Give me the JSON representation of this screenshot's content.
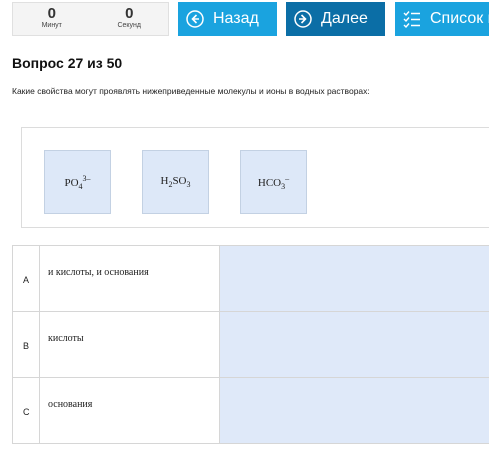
{
  "timer": {
    "minutes_value": "0",
    "minutes_label": "Минут",
    "seconds_value": "0",
    "seconds_label": "Секунд"
  },
  "nav": {
    "back_label": "Назад",
    "next_label": "Далее",
    "list_label": "Список в"
  },
  "question": {
    "title": "Вопрос 27 из 50",
    "text": "Какие свойства могут проявлять нижеприведенные молекулы и ионы в водных растворах:"
  },
  "options": [
    {
      "base": "PO",
      "sub": "4",
      "sup": "3–"
    },
    {
      "pre": "H",
      "sub1": "2",
      "mid": "SO",
      "sub2": "3"
    },
    {
      "base": "HCO",
      "sub": "3",
      "sup": "–"
    }
  ],
  "answers": [
    {
      "letter": "A",
      "text": "и кислоты, и основания"
    },
    {
      "letter": "B",
      "text": "кислоты"
    },
    {
      "letter": "C",
      "text": "основания"
    }
  ],
  "colors": {
    "button_light": "#1aa3df",
    "button_dark": "#0b6ea6",
    "chip_fill": "#dde8f8",
    "drop_zone": "#dfe9f9"
  },
  "icons": [
    "arrow-left-circle-icon",
    "arrow-right-circle-icon",
    "checklist-icon"
  ]
}
